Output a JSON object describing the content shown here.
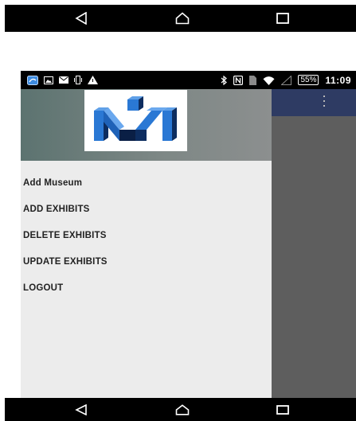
{
  "status_bar": {
    "battery": "55%",
    "time": "11:09"
  },
  "drawer": {
    "menu_items": [
      {
        "label": "Add Museum"
      },
      {
        "label": "ADD EXHIBITS"
      },
      {
        "label": "DELETE EXHIBITS"
      },
      {
        "label": "UPDATE EXHIBITS"
      },
      {
        "label": "LOGOUT"
      }
    ]
  },
  "colors": {
    "toolbar": "#2e3b63",
    "drawer_bg": "#ececec",
    "scrim": "#5e5e5e",
    "logo_blue": "#2a78d4"
  },
  "icons": {
    "nav": [
      "back-icon",
      "home-icon",
      "recents-icon"
    ],
    "status_left": [
      "app-icon",
      "image-icon",
      "mail-icon",
      "vibrate-icon",
      "alert-icon"
    ],
    "status_right": [
      "bluetooth-icon",
      "nfc-icon",
      "sim-icon",
      "wifi-icon",
      "signal-icon"
    ],
    "toolbar": "overflow-menu-icon",
    "logo": "museum-logo"
  }
}
